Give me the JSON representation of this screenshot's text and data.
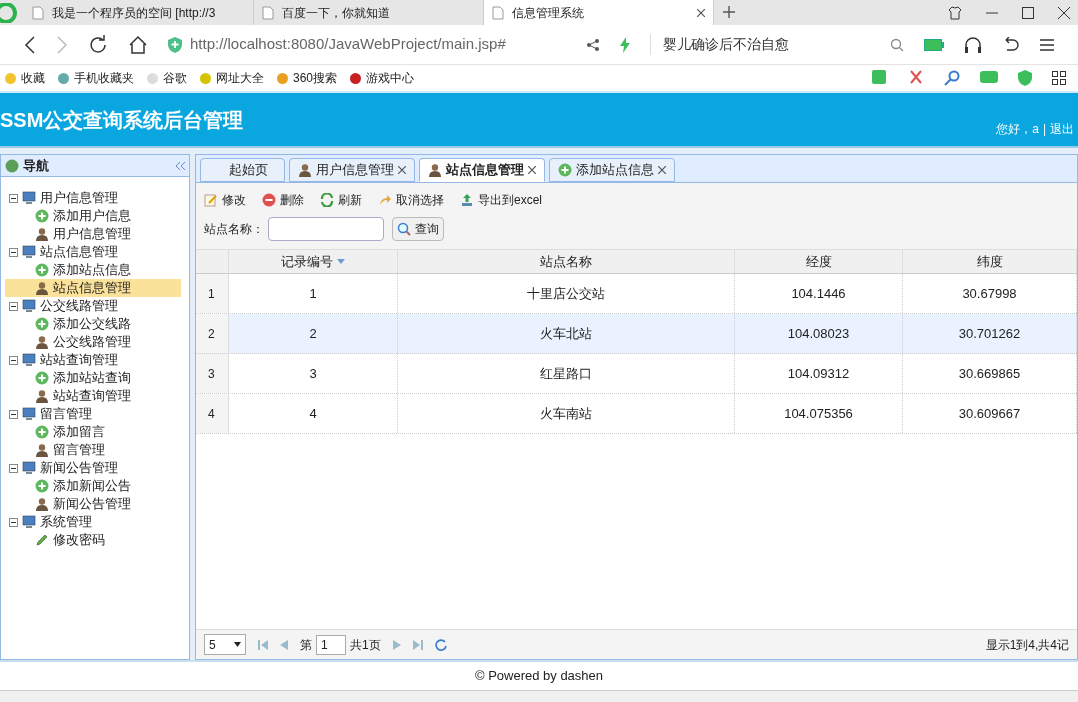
{
  "browser": {
    "tabs": [
      {
        "title": "我是一个程序员的空间 [http://3",
        "selected": false,
        "closable": false
      },
      {
        "title": "百度一下，你就知道",
        "selected": false,
        "closable": false
      },
      {
        "title": "信息管理系统",
        "selected": true,
        "closable": true
      }
    ],
    "address": "http://localhost:8080/JavaWebProject/main.jsp#",
    "search_value": "婴儿确诊后不治自愈",
    "bookmarks": [
      "收藏",
      "手机收藏夹",
      "谷歌",
      "网址大全",
      "360搜索",
      "游戏中心"
    ]
  },
  "header": {
    "title": "SSM公交查询系统后台管理",
    "greeting": "您好，a",
    "separator": "|",
    "logout": "退出"
  },
  "sidebar": {
    "title": "导航",
    "items": [
      {
        "label": "用户信息管理",
        "expanded": true,
        "children": [
          {
            "label": "添加用户信息",
            "kind": "add",
            "selected": false
          },
          {
            "label": "用户信息管理",
            "kind": "user",
            "selected": false
          }
        ]
      },
      {
        "label": "站点信息管理",
        "expanded": true,
        "children": [
          {
            "label": "添加站点信息",
            "kind": "add",
            "selected": false
          },
          {
            "label": "站点信息管理",
            "kind": "user",
            "selected": true
          }
        ]
      },
      {
        "label": "公交线路管理",
        "expanded": true,
        "children": [
          {
            "label": "添加公交线路",
            "kind": "add",
            "selected": false
          },
          {
            "label": "公交线路管理",
            "kind": "user",
            "selected": false
          }
        ]
      },
      {
        "label": "站站查询管理",
        "expanded": true,
        "children": [
          {
            "label": "添加站站查询",
            "kind": "add",
            "selected": false
          },
          {
            "label": "站站查询管理",
            "kind": "user",
            "selected": false
          }
        ]
      },
      {
        "label": "留言管理",
        "expanded": true,
        "children": [
          {
            "label": "添加留言",
            "kind": "add",
            "selected": false
          },
          {
            "label": "留言管理",
            "kind": "user",
            "selected": false
          }
        ]
      },
      {
        "label": "新闻公告管理",
        "expanded": true,
        "children": [
          {
            "label": "添加新闻公告",
            "kind": "add",
            "selected": false
          },
          {
            "label": "新闻公告管理",
            "kind": "user",
            "selected": false
          }
        ]
      },
      {
        "label": "系统管理",
        "expanded": true,
        "children": [
          {
            "label": "修改密码",
            "kind": "edit",
            "selected": false
          }
        ]
      }
    ]
  },
  "tabs": [
    {
      "label": "起始页",
      "kind": "home",
      "selected": false,
      "closable": false
    },
    {
      "label": "用户信息管理",
      "kind": "user",
      "selected": false,
      "closable": true
    },
    {
      "label": "站点信息管理",
      "kind": "user",
      "selected": true,
      "closable": true
    },
    {
      "label": "添加站点信息",
      "kind": "add",
      "selected": false,
      "closable": true
    }
  ],
  "toolbar": [
    {
      "label": "修改",
      "kind": "edit"
    },
    {
      "label": "删除",
      "kind": "delete"
    },
    {
      "label": "刷新",
      "kind": "refresh"
    },
    {
      "label": "取消选择",
      "kind": "undo"
    },
    {
      "label": "导出到excel",
      "kind": "export"
    }
  ],
  "search": {
    "label": "站点名称：",
    "button": "查询"
  },
  "table": {
    "columns": [
      "记录编号",
      "站点名称",
      "经度",
      "纬度"
    ],
    "rows": [
      {
        "index": "1",
        "cells": [
          "1",
          "十里店公交站",
          "104.1446",
          "30.67998"
        ],
        "selected": false
      },
      {
        "index": "2",
        "cells": [
          "2",
          "火车北站",
          "104.08023",
          "30.701262"
        ],
        "selected": true
      },
      {
        "index": "3",
        "cells": [
          "3",
          "红星路口",
          "104.09312",
          "30.669865"
        ],
        "selected": false
      },
      {
        "index": "4",
        "cells": [
          "4",
          "火车南站",
          "104.075356",
          "30.609667"
        ],
        "selected": false
      }
    ]
  },
  "pager": {
    "page_size": "5",
    "page_prefix": "第",
    "page": "1",
    "page_total": "共1页",
    "summary": "显示1到4,共4记"
  },
  "footer": "© Powered by dashen"
}
